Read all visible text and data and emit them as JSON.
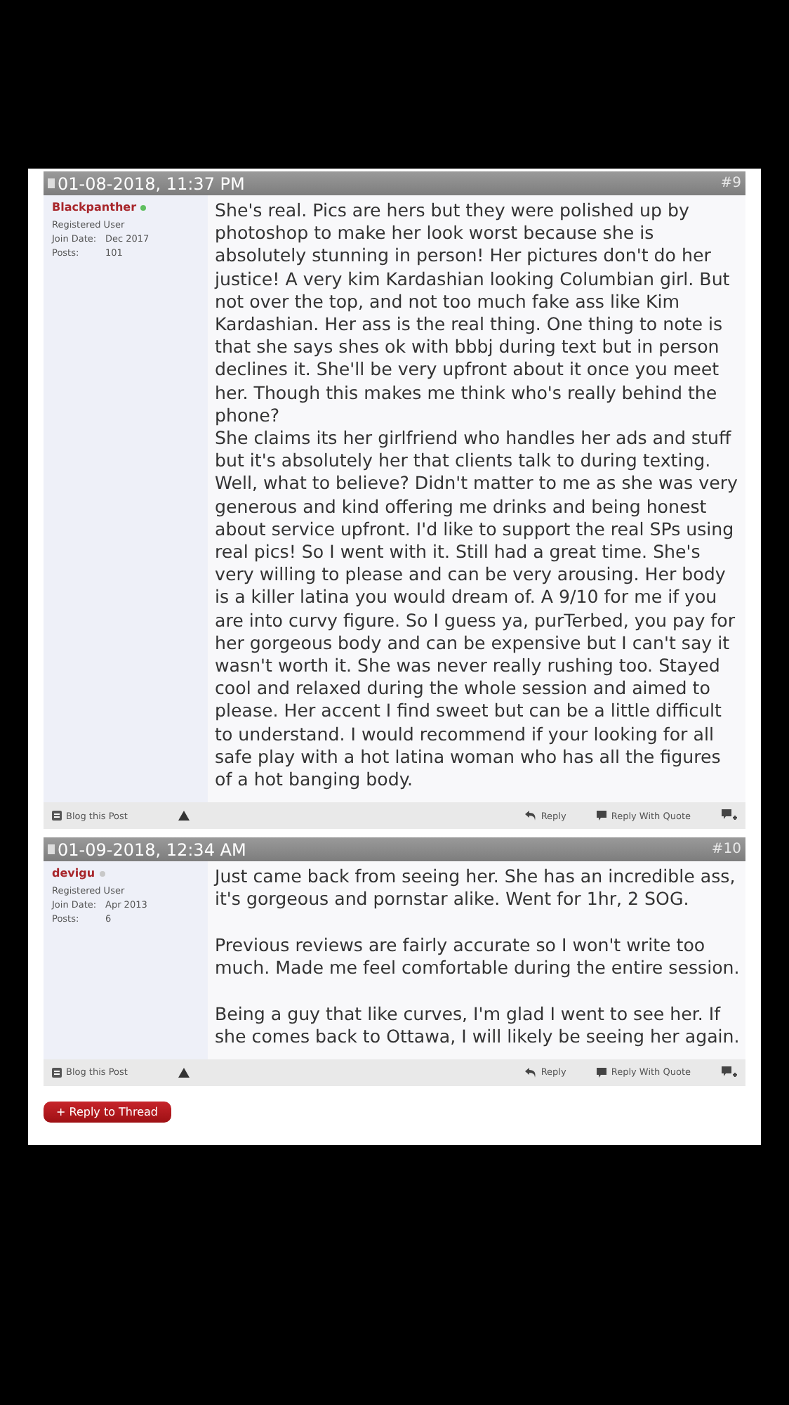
{
  "posts": [
    {
      "date": "01-08-2018, 11:37 PM",
      "number": "#9",
      "user": {
        "name": "Blackpanther",
        "online": true,
        "role": "Registered User",
        "join_label": "Join Date:",
        "join_date": "Dec 2017",
        "posts_label": "Posts:",
        "posts": "101"
      },
      "body": "She's real. Pics are hers but they were polished up by photoshop to make her look worst because she is absolutely stunning in person! Her pictures don't do her justice! A very kim Kardashian looking Columbian girl. But not over the top, and not too much fake ass like Kim Kardashian. Her ass is the real thing. One thing to note is that she says shes ok with bbbj during text but in person declines it. She'll be very upfront about it once you meet her. Though this makes me think who's really behind the phone?\nShe claims its her girlfriend who handles her ads and stuff but it's absolutely her that clients talk to during texting. Well, what to believe? Didn't matter to me as she was very generous and kind offering me drinks and being honest about service upfront. I'd like to support the real SPs using real pics! So I went with it. Still had a great time. She's very willing to please and can be very arousing. Her body is a killer latina you would dream of. A 9/10 for me if you are into curvy figure. So I guess ya, purTerbed, you pay for her gorgeous body and can be expensive but I can't say it wasn't worth it. She was never really rushing too. Stayed cool and relaxed during the whole session and aimed to please. Her accent I find sweet but can be a little difficult to understand. I would recommend if your looking for all safe play with a hot latina woman who has all the figures of a hot banging body.",
      "footer": {
        "blog": "Blog this Post",
        "reply": "Reply",
        "quote": "Reply With Quote"
      }
    },
    {
      "date": "01-09-2018, 12:34 AM",
      "number": "#10",
      "user": {
        "name": "devigu",
        "online": false,
        "role": "Registered User",
        "join_label": "Join Date:",
        "join_date": "Apr 2013",
        "posts_label": "Posts:",
        "posts": "6"
      },
      "body": "Just came back from seeing her. She has an incredible ass, it's gorgeous and pornstar alike. Went for 1hr, 2 SOG.\n\nPrevious reviews are fairly accurate so I won't write too much. Made me feel comfortable during the entire session.\n\nBeing a guy that like curves, I'm glad I went to see her. If she comes back to Ottawa, I will likely be seeing her again.",
      "footer": {
        "blog": "Blog this Post",
        "reply": "Reply",
        "quote": "Reply With Quote"
      }
    }
  ],
  "reply_button": "+ Reply to Thread"
}
